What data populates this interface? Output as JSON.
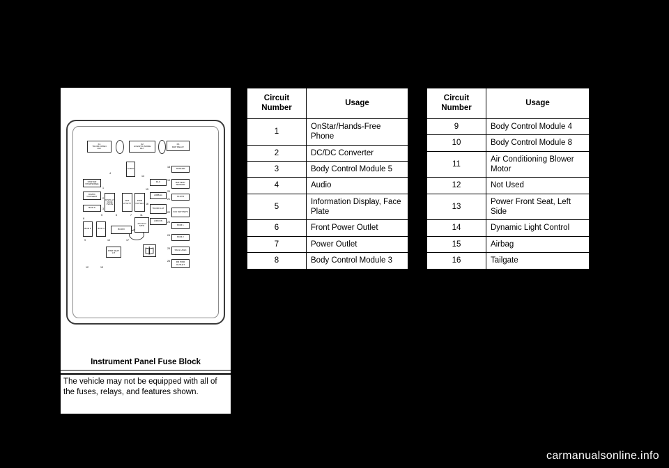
{
  "figure": {
    "caption": "Instrument Panel Fuse Block",
    "note": "The vehicle may not be equipped with all of the fuses, relays, and features shown.",
    "relays": [
      {
        "id": "k1",
        "line1": "K1",
        "line2": "TRUNK OPEN",
        "line3": "RLY"
      },
      {
        "id": "k2",
        "line1": "K2",
        "line2": "LOGISTIC MODE",
        "line3": "RLY"
      },
      {
        "id": "k3",
        "line1": "K3",
        "line2": "RAP RELAY"
      }
    ],
    "fuse_labels": [
      {
        "id": "trailer",
        "text": "TRAILER"
      },
      {
        "id": "battery-sensor",
        "text": "BATTERY SENSOR"
      },
      {
        "id": "dlc",
        "text": "DLC"
      },
      {
        "id": "airbag",
        "text": "AIRBAG"
      },
      {
        "id": "clstr",
        "text": "CLSTR"
      },
      {
        "id": "trunk-lat",
        "text": "TRUNK LAT"
      },
      {
        "id": "aircon",
        "text": "A/RCON"
      },
      {
        "id": "ign-sw-pepsb",
        "text": "IGN SW/ PEPS"
      },
      {
        "id": "bcm1",
        "text": "BCM 1"
      },
      {
        "id": "bcm2",
        "text": "BCM 2"
      },
      {
        "id": "sscl-unlk",
        "text": "SSCL UNLK"
      },
      {
        "id": "rr-pwr-outlet",
        "text": "RR PWR OUTLET"
      },
      {
        "id": "onstar-handsfree",
        "text": "ONSTAR HANDSFREE"
      },
      {
        "id": "dcdc-converter",
        "text": "DC/DC CONVERT"
      },
      {
        "id": "bcm5",
        "text": "BCM 5"
      },
      {
        "id": "bcm8-left",
        "text": "BCM 8"
      },
      {
        "id": "bcm4",
        "text": "BCM 4"
      },
      {
        "id": "bcm8-mid",
        "text": "BCM 8"
      },
      {
        "id": "audio",
        "text": "AUDIO"
      },
      {
        "id": "display-face-plate",
        "text": "DISPLAY FACE PLATE"
      },
      {
        "id": "frt-utility",
        "text": "FRT UTILITY"
      },
      {
        "id": "pwr-outlet",
        "text": "PWR OUTLET"
      },
      {
        "id": "ac-elo-mtr",
        "text": "A/C ELO MTR"
      },
      {
        "id": "pwr-seat-lh",
        "text": "PWR SEAT LH"
      }
    ],
    "number_labels": [
      "1",
      "2",
      "3",
      "4",
      "5",
      "6",
      "7",
      "8",
      "9",
      "10",
      "11",
      "12",
      "13",
      "14",
      "15",
      "16",
      "17",
      "18",
      "19",
      "20",
      "21",
      "22",
      "23",
      "24",
      "25",
      "26"
    ]
  },
  "tables": {
    "headers": {
      "circuit_number": "Circuit Number",
      "usage": "Usage"
    },
    "left_rows": [
      {
        "number": "1",
        "usage": "OnStar/Hands-Free Phone"
      },
      {
        "number": "2",
        "usage": "DC/DC Converter"
      },
      {
        "number": "3",
        "usage": "Body Control Module 5"
      },
      {
        "number": "4",
        "usage": "Audio"
      },
      {
        "number": "5",
        "usage": "Information Display, Face Plate"
      },
      {
        "number": "6",
        "usage": "Front Power Outlet"
      },
      {
        "number": "7",
        "usage": "Power Outlet"
      },
      {
        "number": "8",
        "usage": "Body Control Module 3"
      }
    ],
    "right_rows": [
      {
        "number": "9",
        "usage": "Body Control Module 4"
      },
      {
        "number": "10",
        "usage": "Body Control Module 8"
      },
      {
        "number": "11",
        "usage": "Air Conditioning Blower Motor"
      },
      {
        "number": "12",
        "usage": "Not Used"
      },
      {
        "number": "13",
        "usage": "Power Front Seat, Left Side"
      },
      {
        "number": "14",
        "usage": "Dynamic Light Control"
      },
      {
        "number": "15",
        "usage": "Airbag"
      },
      {
        "number": "16",
        "usage": "Tailgate"
      }
    ]
  },
  "footer": {
    "watermark": "carmanualsonline.info"
  }
}
